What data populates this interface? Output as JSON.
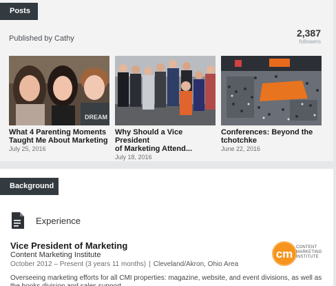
{
  "posts": {
    "tab_label": "Posts",
    "published_by": "Published by Cathy",
    "followers_count": "2,387",
    "followers_label": "followers",
    "items": [
      {
        "title_line1": "What 4 Parenting Moments",
        "title_line2": "Taught Me About Marketing",
        "date": "July 25, 2016"
      },
      {
        "title_line1": "Why Should a Vice President",
        "title_line2": "of Marketing Attend...",
        "date": "July 18, 2016"
      },
      {
        "title_line1": "Conferences: Beyond the",
        "title_line2": "tchotchke",
        "date": "June 22, 2016"
      }
    ]
  },
  "background": {
    "tab_label": "Background",
    "experience_heading": "Experience",
    "job": {
      "title": "Vice President of Marketing",
      "company": "Content Marketing Institute",
      "dates": "October 2012 – Present (3 years 11 months)",
      "separator": "|",
      "location": "Cleveland/Akron, Ohio Area",
      "description": "Overseeing marketing efforts for all CMI properties: magazine, website, and event divisions, as well as the books division and sales support."
    },
    "logo": {
      "mark": "cm",
      "line1": "CONTENT",
      "line2": "MARKETING",
      "line3": "INSTITUTE",
      "color": "#f7941d"
    }
  },
  "colors": {
    "tab_bg": "#333a40",
    "page_bg": "#e6e7e8",
    "card_bg": "#f3f3f3"
  }
}
